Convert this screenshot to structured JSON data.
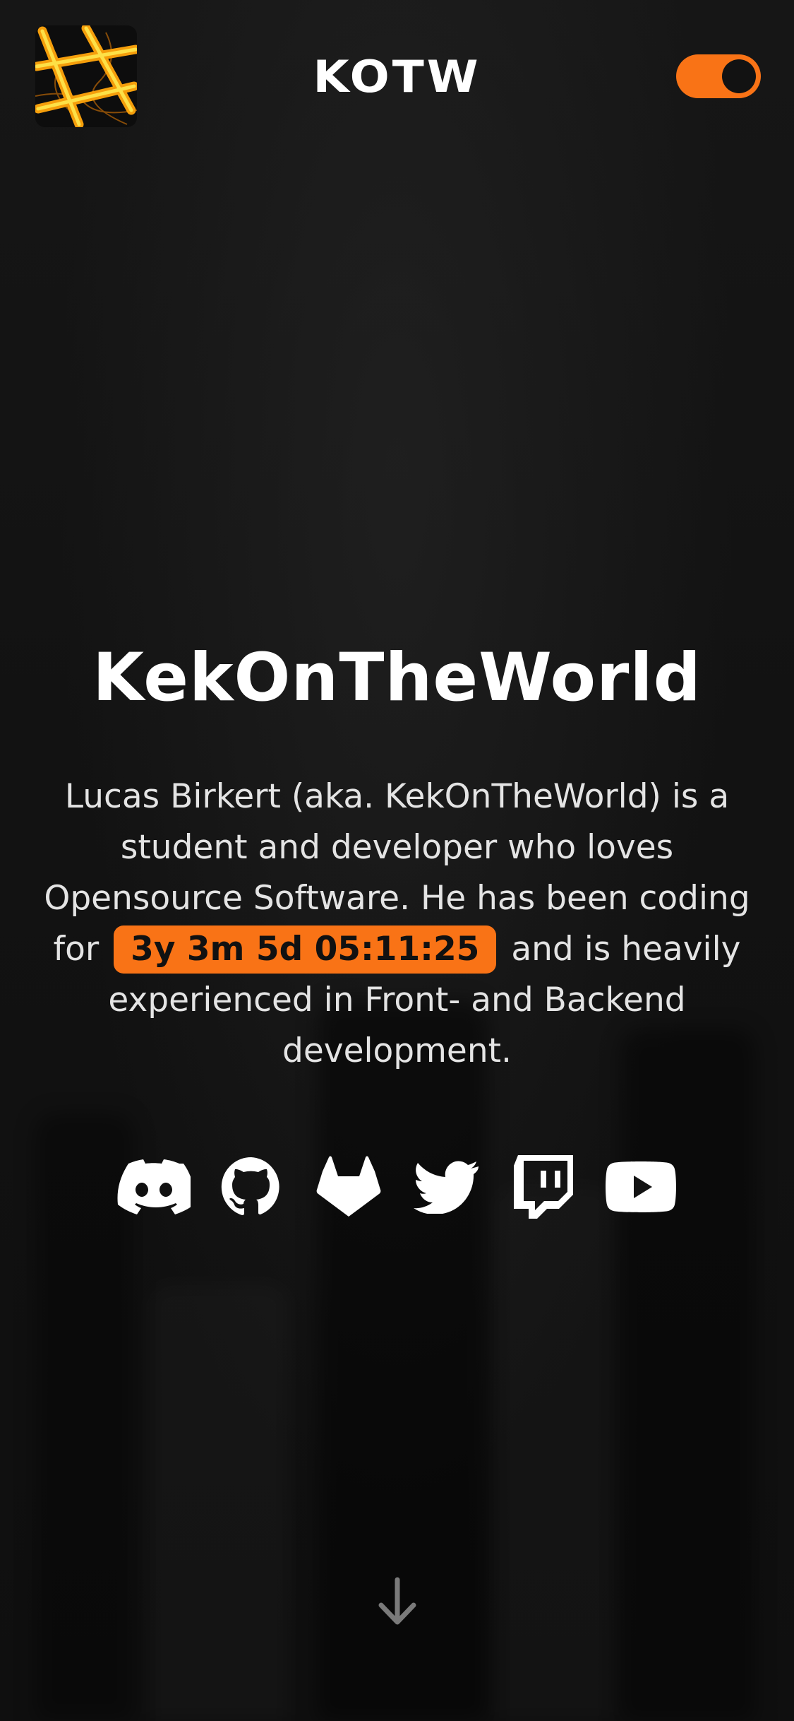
{
  "header": {
    "brand": "KOTW",
    "logo_icon": "lava-cross-logo-icon",
    "theme_toggle_state": "on",
    "accent_color": "#f97316"
  },
  "hero": {
    "title": "KekOnTheWorld",
    "bio_before": "Lucas Birkert (aka. KekOnTheWorld) is a student and developer who loves Opensource Software. He has been coding for",
    "coding_duration": "3y 3m 5d 05:11:25",
    "bio_after": "and is heavily experienced in Front- and Backend development."
  },
  "socials": [
    {
      "name": "Discord",
      "icon": "discord-icon"
    },
    {
      "name": "GitHub",
      "icon": "github-icon"
    },
    {
      "name": "GitLab",
      "icon": "gitlab-icon"
    },
    {
      "name": "Twitter",
      "icon": "twitter-icon"
    },
    {
      "name": "Twitch",
      "icon": "twitch-icon"
    },
    {
      "name": "YouTube",
      "icon": "youtube-icon"
    }
  ],
  "scroll_hint_icon": "arrow-down-icon"
}
